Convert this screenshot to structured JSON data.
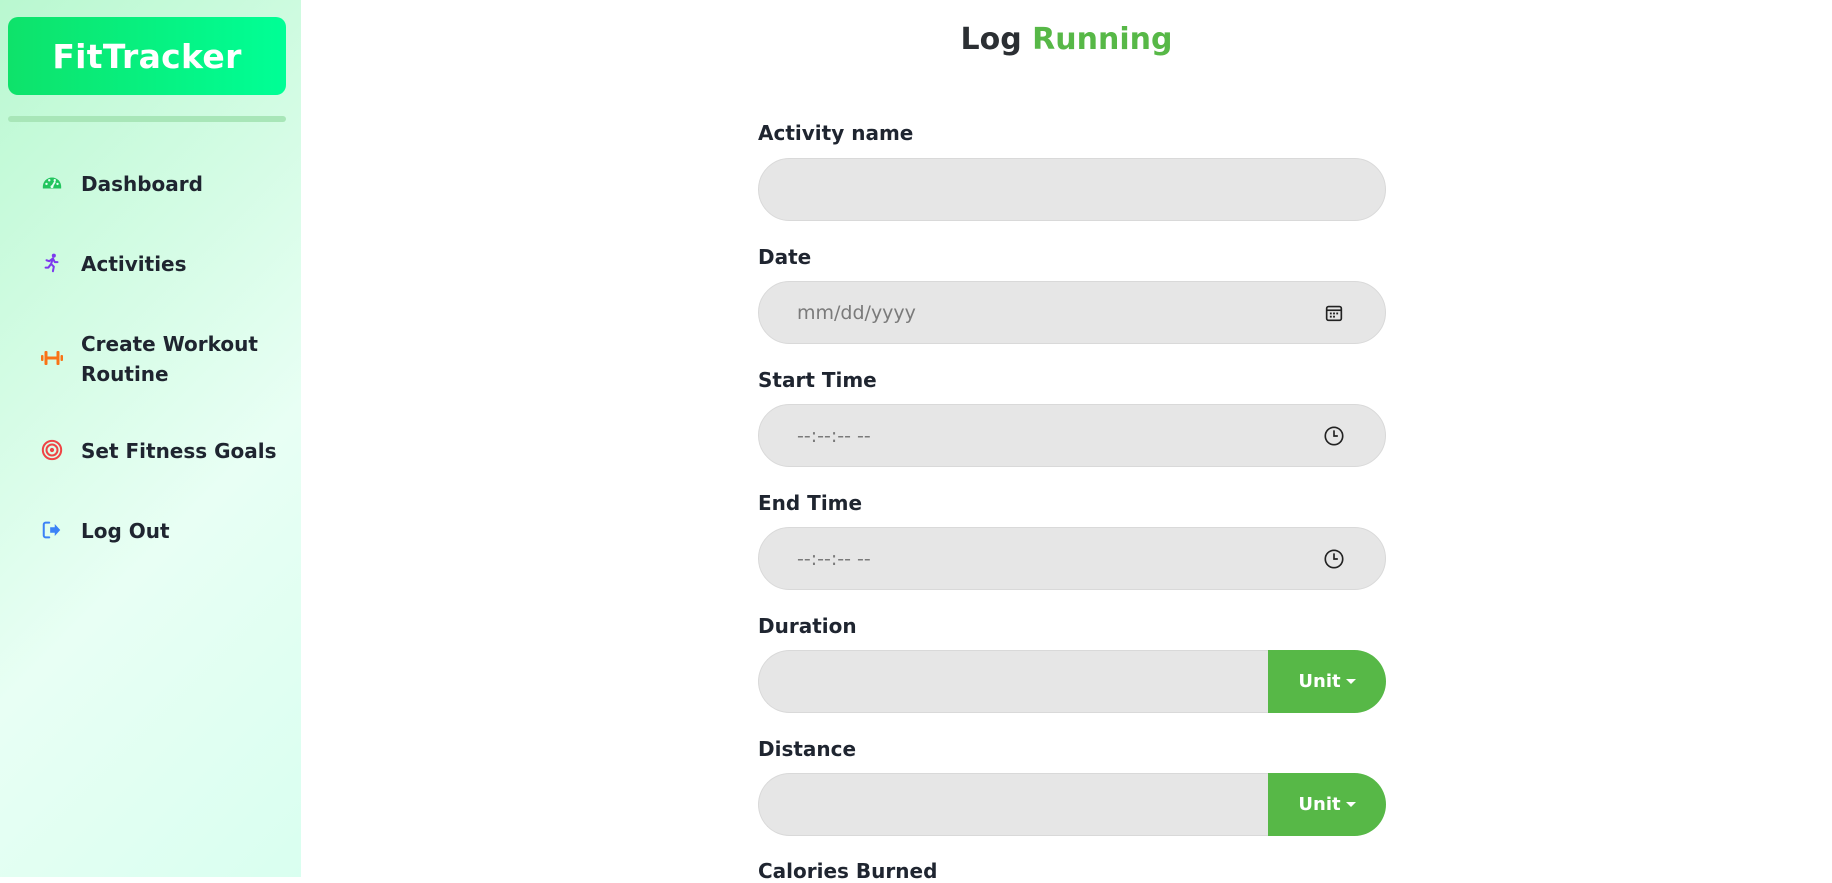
{
  "app": {
    "name": "FitTracker"
  },
  "sidebar": {
    "items": [
      {
        "label": "Dashboard",
        "icon": "gauge-icon",
        "color": "#22c55e"
      },
      {
        "label": "Activities",
        "icon": "running-person-icon",
        "color": "#7c3aed"
      },
      {
        "label": "Create Workout Routine",
        "icon": "dumbbell-icon",
        "color": "#f97316"
      },
      {
        "label": "Set Fitness Goals",
        "icon": "target-icon",
        "color": "#ef4444"
      },
      {
        "label": "Log Out",
        "icon": "logout-icon",
        "color": "#3b82f6"
      }
    ]
  },
  "page": {
    "title_prefix": "Log",
    "title_activity": "Running"
  },
  "form": {
    "activity_name": {
      "label": "Activity name",
      "value": ""
    },
    "date": {
      "label": "Date",
      "placeholder": "mm/dd/yyyy"
    },
    "start_time": {
      "label": "Start Time",
      "placeholder": "--:--:-- --"
    },
    "end_time": {
      "label": "End Time",
      "placeholder": "--:--:-- --"
    },
    "duration": {
      "label": "Duration",
      "unit_button": "Unit"
    },
    "distance": {
      "label": "Distance",
      "unit_button": "Unit"
    },
    "calories": {
      "label": "Calories Burned"
    }
  },
  "colors": {
    "accent": "#57b847",
    "logo": "#00ff96",
    "input_bg": "#e6e6e6"
  }
}
